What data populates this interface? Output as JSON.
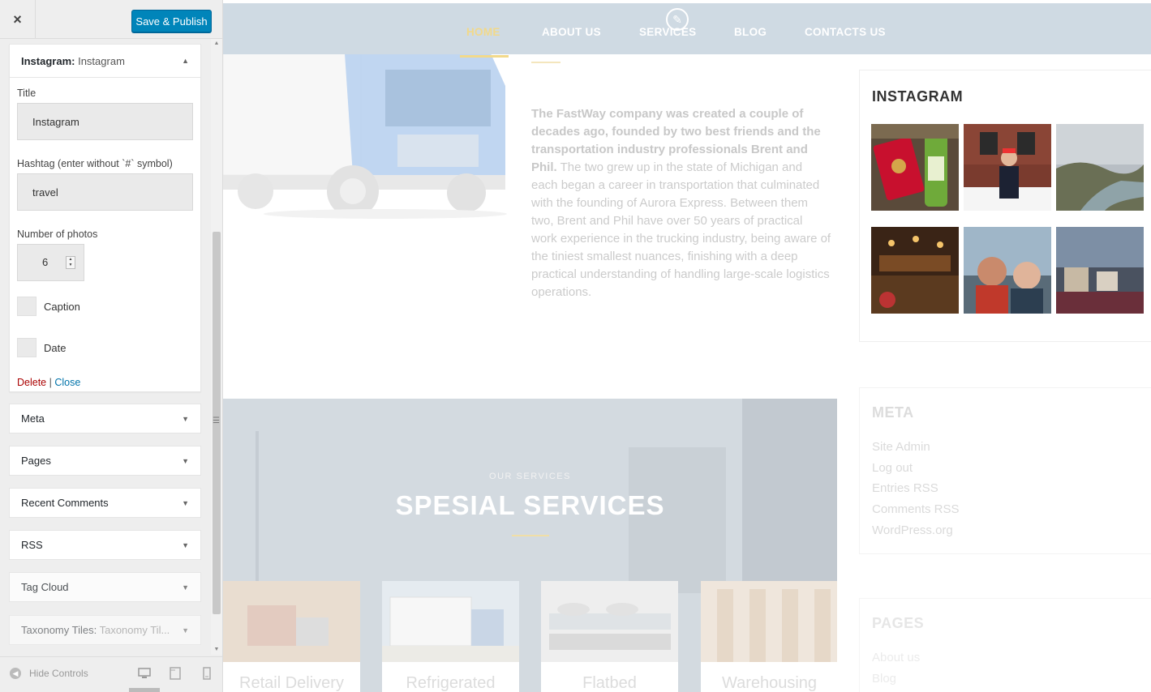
{
  "sidebar": {
    "close_icon": "×",
    "publish_label": "Save & Publish",
    "open_widget": {
      "title_type": "Instagram:",
      "title_name": "Instagram",
      "fields": {
        "title_label": "Title",
        "title_value": "Instagram",
        "hashtag_label": "Hashtag (enter without `#` symbol)",
        "hashtag_value": "travel",
        "photos_label": "Number of photos",
        "photos_value": "6",
        "caption_label": "Caption",
        "date_label": "Date"
      },
      "delete_label": "Delete",
      "separator": "|",
      "close_label": "Close"
    },
    "widgets": [
      {
        "name": "Meta"
      },
      {
        "name": "Pages"
      },
      {
        "name": "Recent Comments"
      },
      {
        "name": "RSS"
      },
      {
        "name": "Tag Cloud"
      },
      {
        "name": "Taxonomy Tiles:",
        "sub": "Taxonomy Til..."
      }
    ],
    "footer": {
      "hide_label": "Hide Controls"
    }
  },
  "preview": {
    "nav": [
      "HOME",
      "ABOUT US",
      "SERVICES",
      "BLOG",
      "CONTACTS US"
    ],
    "active_nav": "HOME",
    "about": {
      "bold": "The FastWay company was created a couple of decades ago, founded by two best  friends and the transportation industry professionals Brent and Phil.",
      "rest": "The two grew up in the state of Michigan and each began a career in transportation that culminated with the founding of Aurora Express. Between them two, Brent and Phil have over 50 years of practical work experience in the trucking industry, being aware of the tiniest smallest nuances, finishing with a deep practical understanding of handling large-scale logistics operations."
    },
    "instagram_title": "INSTAGRAM",
    "meta": {
      "title": "META",
      "links": [
        "Site Admin",
        "Log out",
        "Entries RSS",
        "Comments RSS",
        "WordPress.org"
      ]
    },
    "pages": {
      "title": "PAGES",
      "links": [
        "About us",
        "Blog"
      ]
    },
    "services": {
      "subtitle": "OUR SERVICES",
      "title": "SPESIAL SERVICES",
      "cards": [
        "Retail Delivery",
        "Refrigerated",
        "Flatbed",
        "Warehousing"
      ]
    }
  },
  "colors": {
    "accent": "#0085ba",
    "nav_bg": "#cfdae3",
    "nav_active": "#f2d98a",
    "delete": "#aa0000",
    "link": "#0073aa"
  }
}
